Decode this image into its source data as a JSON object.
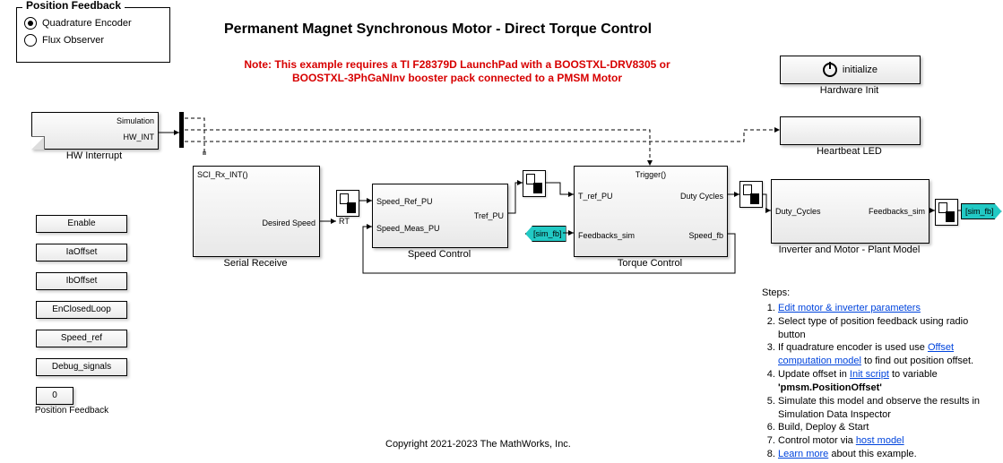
{
  "feedback_panel": {
    "legend": "Position Feedback",
    "opt1": "Quadrature Encoder",
    "opt2": "Flux Observer"
  },
  "title": "Permanent Magnet Synchronous Motor - Direct Torque Control",
  "note": "Note: This example requires a TI F28379D LaunchPad with a BOOSTXL-DRV8305 or BOOSTXL-3PhGaNInv booster pack connected to a PMSM Motor",
  "copyright": "Copyright 2021-2023 The MathWorks, Inc.",
  "hw_int": {
    "label": "HW Interrupt",
    "top": "Simulation",
    "port": "HW_INT"
  },
  "serial_receive": {
    "label": "Serial Receive",
    "fn": "SCI_Rx_INT()",
    "out": "Desired Speed"
  },
  "rt_label": "RT",
  "speed_control": {
    "label": "Speed Control",
    "in1": "Speed_Ref_PU",
    "in2": "Speed_Meas_PU",
    "out": "Tref_PU"
  },
  "torque_control": {
    "label": "Torque Control",
    "fn": "Trigger()",
    "in1": "T_ref_PU",
    "in2": "Feedbacks_sim",
    "out1": "Duty Cycles",
    "out2": "Speed_fb"
  },
  "inverter": {
    "label": "Inverter and Motor - Plant Model",
    "in": "Duty_Cycles",
    "out": "Feedbacks_sim"
  },
  "initialize": {
    "label": "Hardware Init",
    "text": "initialize"
  },
  "heartbeat": {
    "label": "Heartbeat LED"
  },
  "tag_sim_fb": "[sim_fb]",
  "thin": {
    "enable": "Enable",
    "ia": "IaOffset",
    "ib": "IbOffset",
    "enc": "EnClosedLoop",
    "spd": "Speed_ref",
    "dbg": "Debug_signals",
    "posfb_val": "0",
    "posfb_lbl": "Position Feedback"
  },
  "steps": {
    "hdr": "Steps:",
    "s1a": "Edit motor & inverter parameters",
    "s2": "Select type of position feedback using radio button",
    "s3a": "If quadrature encoder is used use ",
    "s3link": "Offset computation model",
    "s3b": " to find out position offset.",
    "s4a": "Update offset in ",
    "s4link": "Init script",
    "s4b": " to variable ",
    "s4c": "'pmsm.PositionOffset'",
    "s5": "Simulate this model and observe the results in Simulation Data Inspector",
    "s6": "Build, Deploy & Start",
    "s7a": "Control motor via ",
    "s7link": "host model",
    "s8link": "Learn more",
    "s8b": " about this example."
  }
}
